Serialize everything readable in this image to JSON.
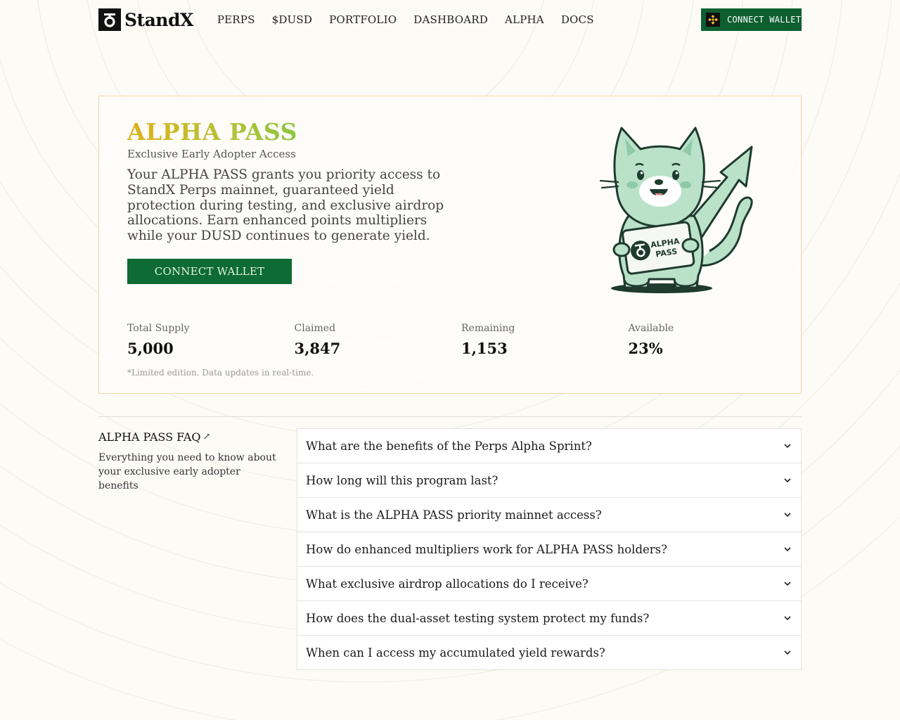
{
  "brand": {
    "name": "StandX",
    "logo_icon": "standx-logo-icon"
  },
  "nav": {
    "items": [
      {
        "label": "PERPS"
      },
      {
        "label": "$DUSD"
      },
      {
        "label": "PORTFOLIO"
      },
      {
        "label": "DASHBOARD"
      },
      {
        "label": "ALPHA"
      },
      {
        "label": "DOCS"
      }
    ],
    "connect_label": "CONNECT WALLET",
    "connect_icon": "bnb-icon"
  },
  "hero": {
    "title": "ALPHA PASS",
    "subtitle": "Exclusive Early Adopter Access",
    "description": "Your ALPHA PASS grants you priority access to StandX Perps mainnet, guaranteed yield protection during testing, and exclusive airdrop allocations. Earn enhanced points multipliers while your DUSD continues to generate yield.",
    "cta_label": "CONNECT WALLET",
    "card_text_line1": "ALPHA",
    "card_text_line2": "PASS",
    "stats": [
      {
        "label": "Total Supply",
        "value": "5,000"
      },
      {
        "label": "Claimed",
        "value": "3,847"
      },
      {
        "label": "Remaining",
        "value": "1,153"
      },
      {
        "label": "Available",
        "value": "23%"
      }
    ],
    "note": "*Limited edition. Data updates in real-time."
  },
  "faq": {
    "title": "ALPHA PASS FAQ",
    "title_icon": "external-arrow-icon",
    "description": "Everything you need to know about your exclusive early adopter benefits",
    "items": [
      {
        "question": "What are the benefits of the Perps Alpha Sprint?"
      },
      {
        "question": "How long will this program last?"
      },
      {
        "question": "What is the ALPHA PASS priority mainnet access?"
      },
      {
        "question": "How do enhanced multipliers work for ALPHA PASS holders?"
      },
      {
        "question": "What exclusive airdrop allocations do I receive?"
      },
      {
        "question": "How does the dual-asset testing system protect my funds?"
      },
      {
        "question": "When can I access my accumulated yield rewards?"
      }
    ]
  },
  "colors": {
    "accent_green": "#0d6b33",
    "title_gradient_start": "#e0b11c",
    "title_gradient_end": "#8cc63f",
    "mascot_fill": "#b9e2c9",
    "background": "#fcfbf6"
  }
}
